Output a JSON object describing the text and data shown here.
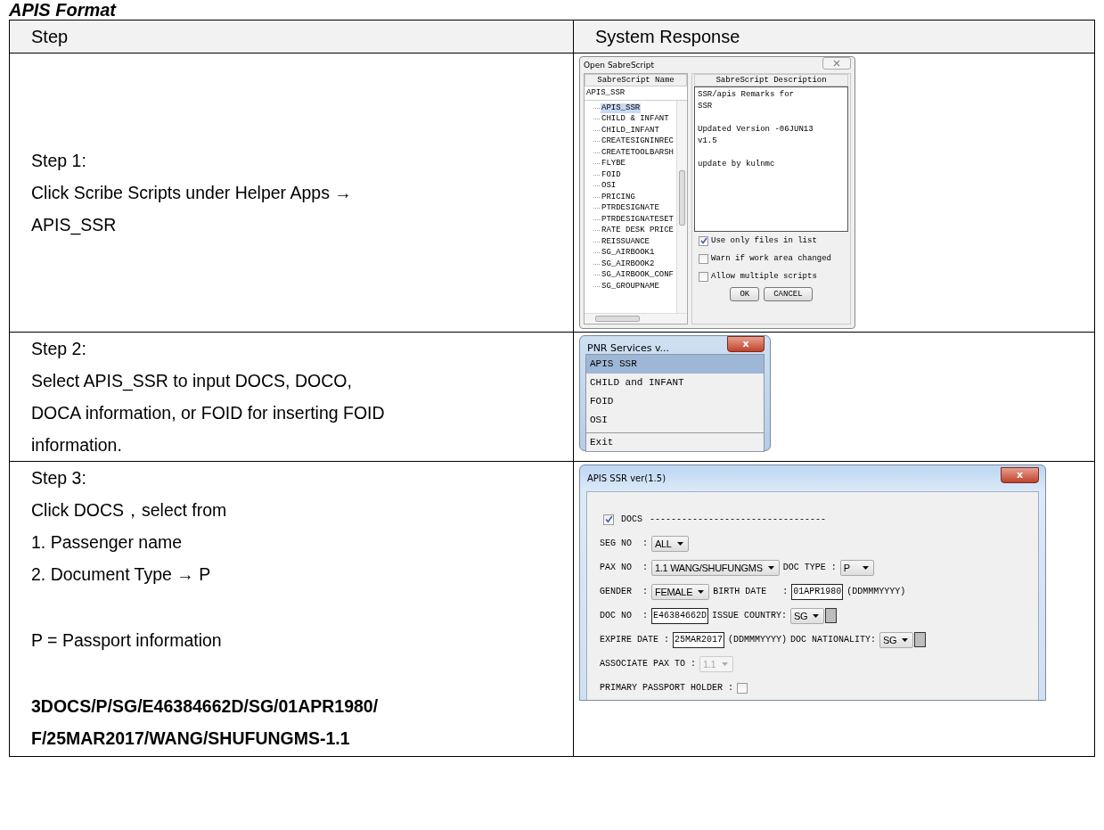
{
  "heading": "APIS Format",
  "table": {
    "columns": [
      "Step",
      "System Response"
    ],
    "rows": [
      {
        "step": {
          "blocks": [
            [
              {
                "text": "Step 1:",
                "bold": false
              },
              {
                "text": "Click Scribe Scripts under Helper Apps → APIS_SSR",
                "bold": false
              }
            ]
          ]
        },
        "response": {
          "kind": "script-picker",
          "title": "Open SabreScript",
          "name_header": "SabreScript Name",
          "description_header": "SabreScript Description",
          "search_value": "APIS_SSR",
          "items": [
            {
              "label": "APIS_SSR",
              "selected": true
            },
            {
              "label": "CHILD & INFANT",
              "selected": false
            },
            {
              "label": "CHILD_INFANT",
              "selected": false
            },
            {
              "label": "CREATESIGNINREC",
              "selected": false
            },
            {
              "label": "CREATETOOLBARSH",
              "selected": false
            },
            {
              "label": "FLYBE",
              "selected": false
            },
            {
              "label": "FOID",
              "selected": false
            },
            {
              "label": "OSI",
              "selected": false
            },
            {
              "label": "PRICING",
              "selected": false
            },
            {
              "label": "PTRDESIGNATE",
              "selected": false
            },
            {
              "label": "PTRDESIGNATESET",
              "selected": false
            },
            {
              "label": "RATE DESK PRICE",
              "selected": false
            },
            {
              "label": "REISSUANCE",
              "selected": false
            },
            {
              "label": "SG_AIRBOOK1",
              "selected": false
            },
            {
              "label": "SG_AIRBOOK2",
              "selected": false
            },
            {
              "label": "SG_AIRBOOK_CONF",
              "selected": false
            },
            {
              "label": "SG_GROUPNAME",
              "selected": false
            }
          ],
          "description": [
            [
              "SSR/apis Remarks for",
              "SSR"
            ],
            [
              "Updated Version -06JUN13",
              "v1.5"
            ],
            [
              "update by kulnmc"
            ]
          ],
          "options": [
            {
              "label": "Use only files in list",
              "checked": true
            },
            {
              "label": "Warn if work area changed",
              "checked": false
            },
            {
              "label": "Allow multiple scripts",
              "checked": false
            }
          ],
          "buttons": [
            "OK",
            "CANCEL"
          ]
        }
      },
      {
        "step": {
          "blocks": [
            [
              {
                "text": "Step 2:",
                "bold": false
              },
              {
                "text": "Select APIS_SSR to input DOCS, DOCO, DOCA information, or FOID for inserting FOID information.",
                "bold": false
              }
            ]
          ]
        },
        "response": {
          "kind": "menu",
          "title": "PNR Services v...",
          "close": "x",
          "items": [
            {
              "label": "APIS SSR",
              "selected": true,
              "separator": false
            },
            {
              "label": "CHILD and INFANT",
              "selected": false,
              "separator": false
            },
            {
              "label": "FOID",
              "selected": false,
              "separator": false
            },
            {
              "label": "OSI",
              "selected": false,
              "separator": false
            },
            {
              "label": "Exit",
              "selected": false,
              "separator": true
            }
          ]
        }
      },
      {
        "step": {
          "blocks": [
            [
              {
                "text": "Step 3:",
                "bold": false
              },
              {
                "text": "Click DOCS，select from",
                "bold": false
              },
              {
                "text": "1. Passenger name",
                "bold": false
              },
              {
                "text": "2. Document Type → P",
                "bold": false
              }
            ],
            [
              {
                "text": "P  =  Passport information",
                "bold": false
              }
            ],
            [
              {
                "text": "3DOCS/P/SG/E46384662D/SG/01APR1980/",
                "bold": true
              },
              {
                "text": "F/25MAR2017/WANG/SHUFUNGMS-1.1",
                "bold": true
              }
            ]
          ]
        },
        "response": {
          "kind": "form",
          "title": "APIS SSR ver(1.5)",
          "close": "x",
          "lines": [
            [
              {
                "kind": "checkbox",
                "checked": true
              },
              {
                "kind": "label",
                "text": "DOCS"
              },
              {
                "kind": "label",
                "text": "---------------------------------"
              }
            ],
            [
              {
                "kind": "label",
                "text": "SEG NO  :"
              },
              {
                "kind": "select",
                "value": "ALL",
                "disabled": false
              }
            ],
            [
              {
                "kind": "label",
                "text": "PAX NO  :"
              },
              {
                "kind": "select",
                "value": "1.1 WANG/SHUFUNGMS",
                "disabled": false
              },
              {
                "kind": "label",
                "text": "DOC TYPE :"
              },
              {
                "kind": "select",
                "value": "P",
                "disabled": false
              }
            ],
            [
              {
                "kind": "label",
                "text": "GENDER  :"
              },
              {
                "kind": "select",
                "value": "FEMALE",
                "disabled": false
              },
              {
                "kind": "label",
                "text": "BIRTH DATE   :"
              },
              {
                "kind": "input",
                "value": "01APR1980"
              },
              {
                "kind": "label",
                "text": "(DDMMMYYYY)"
              }
            ],
            [
              {
                "kind": "label",
                "text": "DOC NO  :"
              },
              {
                "kind": "input",
                "value": "E46384662D"
              },
              {
                "kind": "label",
                "text": "ISSUE COUNTRY:"
              },
              {
                "kind": "select",
                "value": "SG",
                "disabled": false
              },
              {
                "kind": "swatch"
              }
            ],
            [
              {
                "kind": "label",
                "text": "EXPIRE DATE :"
              },
              {
                "kind": "input",
                "value": "25MAR2017"
              },
              {
                "kind": "label",
                "text": "(DDMMMYYYY)"
              },
              {
                "kind": "label",
                "text": "DOC NATIONALITY:"
              },
              {
                "kind": "select",
                "value": "SG",
                "disabled": false
              },
              {
                "kind": "swatch"
              }
            ],
            [
              {
                "kind": "label",
                "text": "ASSOCIATE PAX TO :"
              },
              {
                "kind": "select",
                "value": "1.1",
                "disabled": true
              }
            ],
            [
              {
                "kind": "label",
                "text": "PRIMARY PASSPORT HOLDER :"
              },
              {
                "kind": "checkbox",
                "checked": false
              }
            ]
          ]
        }
      }
    ]
  }
}
